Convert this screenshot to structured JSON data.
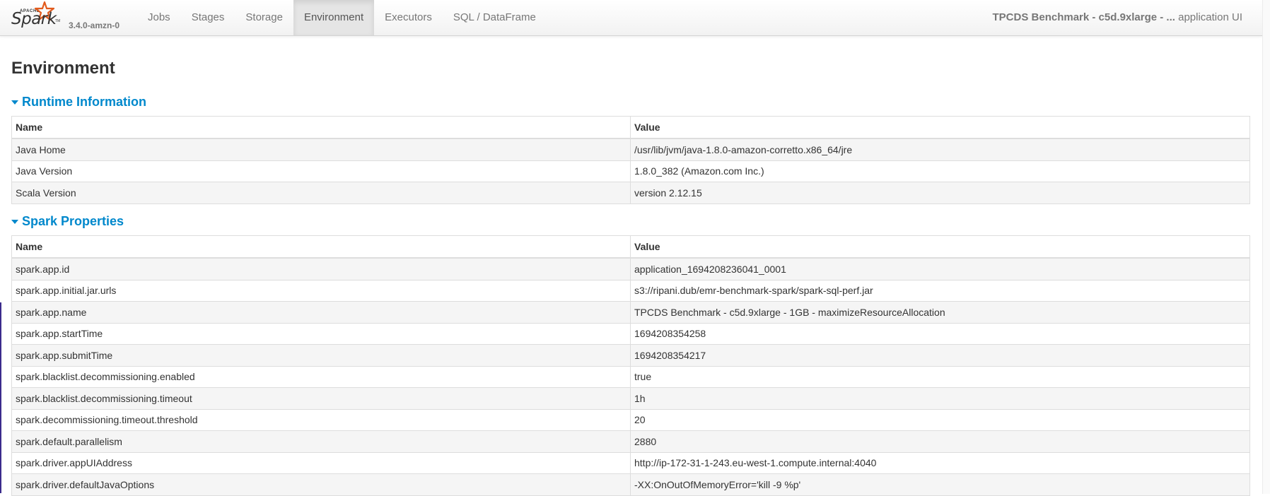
{
  "navbar": {
    "brand_small": "APACHE",
    "brand_name": "Spark",
    "brand_tm": "TM",
    "version": "3.4.0-amzn-0",
    "tabs": [
      {
        "label": "Jobs",
        "active": false
      },
      {
        "label": "Stages",
        "active": false
      },
      {
        "label": "Storage",
        "active": false
      },
      {
        "label": "Environment",
        "active": true
      },
      {
        "label": "Executors",
        "active": false
      },
      {
        "label": "SQL / DataFrame",
        "active": false
      }
    ],
    "app_name": "TPCDS Benchmark - c5d.9xlarge - ...",
    "app_suffix": "application UI"
  },
  "page": {
    "title": "Environment",
    "accent_color": "#0088cc"
  },
  "runtime": {
    "heading": "Runtime Information",
    "columns": [
      "Name",
      "Value"
    ],
    "rows": [
      [
        "Java Home",
        "/usr/lib/jvm/java-1.8.0-amazon-corretto.x86_64/jre"
      ],
      [
        "Java Version",
        "1.8.0_382 (Amazon.com Inc.)"
      ],
      [
        "Scala Version",
        "version 2.12.15"
      ]
    ]
  },
  "spark_properties": {
    "heading": "Spark Properties",
    "columns": [
      "Name",
      "Value"
    ],
    "rows": [
      [
        "spark.app.id",
        "application_1694208236041_0001"
      ],
      [
        "spark.app.initial.jar.urls",
        "s3://ripani.dub/emr-benchmark-spark/spark-sql-perf.jar"
      ],
      [
        "spark.app.name",
        "TPCDS Benchmark - c5d.9xlarge - 1GB - maximizeResourceAllocation"
      ],
      [
        "spark.app.startTime",
        "1694208354258"
      ],
      [
        "spark.app.submitTime",
        "1694208354217"
      ],
      [
        "spark.blacklist.decommissioning.enabled",
        "true"
      ],
      [
        "spark.blacklist.decommissioning.timeout",
        "1h"
      ],
      [
        "spark.decommissioning.timeout.threshold",
        "20"
      ],
      [
        "spark.default.parallelism",
        "2880"
      ],
      [
        "spark.driver.appUIAddress",
        "http://ip-172-31-1-243.eu-west-1.compute.internal:4040"
      ],
      [
        "spark.driver.defaultJavaOptions",
        "-XX:OnOutOfMemoryError='kill -9 %p'"
      ]
    ]
  }
}
